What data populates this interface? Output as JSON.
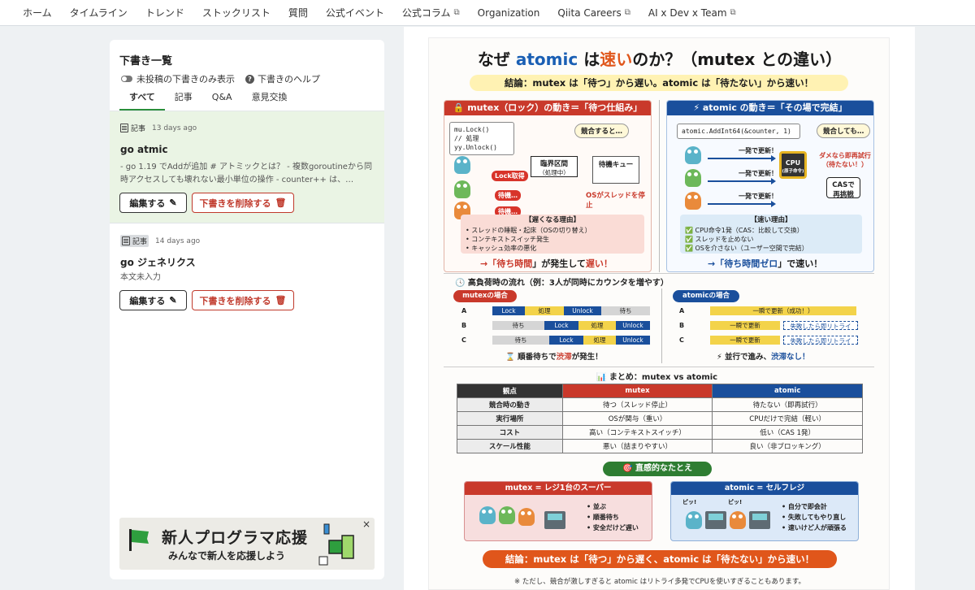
{
  "nav": {
    "items": [
      {
        "label": "ホーム",
        "external": false
      },
      {
        "label": "タイムライン",
        "external": false
      },
      {
        "label": "トレンド",
        "external": false
      },
      {
        "label": "ストックリスト",
        "external": false
      },
      {
        "label": "質問",
        "external": false
      },
      {
        "label": "公式イベント",
        "external": false
      },
      {
        "label": "公式コラム",
        "external": true
      },
      {
        "label": "Organization",
        "external": false
      },
      {
        "label": "Qiita Careers",
        "external": true
      },
      {
        "label": "AI x Dev x Team",
        "external": true
      }
    ]
  },
  "drafts_panel": {
    "title": "下書き一覧",
    "toggle_label": "未投稿の下書きのみ表示",
    "help_label": "下書きのヘルプ",
    "tabs": [
      {
        "label": "すべて",
        "active": true
      },
      {
        "label": "記事",
        "active": false
      },
      {
        "label": "Q&A",
        "active": false
      },
      {
        "label": "意見交換",
        "active": false
      }
    ],
    "drafts": [
      {
        "type": "記事",
        "time": "13 days ago",
        "title": "go atmic",
        "body": "- go 1.19 でAddが追加 # アトミックとは？ - 複数goroutineから同時アクセスしても壊れない最小単位の操作 - counter++ は、…",
        "edit_label": "編集する",
        "delete_label": "下書きを削除する",
        "selected": true
      },
      {
        "type": "記事",
        "time": "14 days ago",
        "title": "go ジェネリクス",
        "body": "本文未入力",
        "edit_label": "編集する",
        "delete_label": "下書きを削除する",
        "selected": false
      }
    ],
    "ad": {
      "line1": "新人プログラマ応援",
      "line2": "みんなで新人を応援しよう",
      "close": "×"
    }
  },
  "infographic": {
    "title_pre": "なぜ ",
    "title_atomic": "atomic",
    "title_mid": " は",
    "title_fast": "速い",
    "title_post": "のか？（mutex との違い）",
    "subtitle": "結論：mutex は「待つ」から遅い。atomic は「待たない」から速い！",
    "mutex_panel": {
      "header": "🔒 mutex（ロック）の動き＝「待つ仕組み」",
      "code": [
        "mu.Lock()",
        "// 処理",
        "yy.Unlock()"
      ],
      "bubble": "競合すると…",
      "lock_tag": "Lock取得",
      "wait1": "待機…",
      "wait2": "待機…",
      "critical": [
        "臨界区間",
        "（処理中）"
      ],
      "queue": "待機キュー",
      "os_stop": "OSがスレッドを停止",
      "reason_title": "【遅くなる理由】",
      "reasons": [
        "• スレッドの睡眠・起床（OSの切り替え）",
        "• コンテキストスイッチ発生",
        "• キャッシュ効率の悪化"
      ],
      "conclusion_pre": "→「",
      "conclusion_mid": "待ち時間",
      "conclusion_post": "」が発生して",
      "conclusion_end": "遅い！"
    },
    "atomic_panel": {
      "header": "⚡ atomic の動き＝「その場で完結」",
      "code": "atomic.AddInt64(&counter, 1)",
      "bubble": "競合しても…",
      "arrow_labels": [
        "一発で更新！",
        "一発で更新！",
        "一発で更新！"
      ],
      "cpu": [
        "CPU",
        "(原子命令)"
      ],
      "retry_note": [
        "ダメなら即再試行",
        "（待たない！）"
      ],
      "cas": [
        "CASで",
        "再挑戦"
      ],
      "reason_title": "【速い理由】",
      "reasons": [
        "✅ CPU命令1発（CAS：比較して交換）",
        "✅ スレッドを止めない",
        "✅ OSを介さない（ユーザー空間で完結）"
      ],
      "conclusion_pre": "→「",
      "conclusion_mid": "待ち時間ゼロ",
      "conclusion_post": "」で速い！"
    },
    "flow": {
      "header": "🕓 高負荷時の流れ（例：3人が同時にカウンタを増やす）",
      "mutex_label": "mutexの場合",
      "atomic_label": "atomicの場合",
      "lanes": [
        "A",
        "B",
        "C"
      ],
      "mutex_lanes": [
        [
          [
            "lock",
            "Lock"
          ],
          [
            "proc",
            "処理"
          ],
          [
            "lock",
            "Unlock"
          ],
          [
            "gray",
            "待ち"
          ]
        ],
        [
          [
            "gray",
            "待ち"
          ],
          [
            "lock",
            "Lock"
          ],
          [
            "proc",
            "処理"
          ],
          [
            "lock",
            "Unlock"
          ]
        ],
        [
          [
            "gray",
            "待ち"
          ],
          [
            "lock",
            "Lock"
          ],
          [
            "proc",
            "処理"
          ],
          [
            "lock",
            "Unlock"
          ]
        ]
      ],
      "atomic_lanes": [
        [
          [
            "proc",
            "一瞬で更新（成功！）"
          ]
        ],
        [
          [
            "proc",
            "一瞬で更新"
          ],
          [
            "dashed",
            "失敗したら即リトライ"
          ]
        ],
        [
          [
            "proc",
            "一瞬で更新"
          ],
          [
            "dashed",
            "失敗したら即リトライ"
          ]
        ]
      ],
      "mutex_foot_pre": "⌛ 順番待ちで",
      "mutex_foot_red": "渋滞",
      "mutex_foot_post": "が発生！",
      "atomic_foot_pre": "⚡ 並行で進み、",
      "atomic_foot_blue": "渋滞なし！"
    },
    "summary": {
      "header": "📊 まとめ：mutex vs atomic",
      "columns": [
        "観点",
        "mutex",
        "atomic"
      ],
      "rows": [
        [
          "競合時の動き",
          "待つ（スレッド停止）",
          "待たない（即再試行）"
        ],
        [
          "実行場所",
          "OSが関与（重い）",
          "CPUだけで完結（軽い）"
        ],
        [
          "コスト",
          "高い（コンテキストスイッチ）",
          "低い（CAS 1発）"
        ],
        [
          "スケール性能",
          "悪い（詰まりやすい）",
          "良い（非ブロッキング）"
        ]
      ]
    },
    "metaphor": {
      "header": "🎯 直感的なたとえ",
      "left_title": "mutex = レジ1台のスーパー",
      "left_items": [
        "• 並ぶ",
        "• 順番待ち",
        "• 安全だけど遅い"
      ],
      "right_title": "atomic = セルフレジ",
      "right_items": [
        "• 自分で即会計",
        "• 失敗してもやり直し",
        "• 速いけど人が頑張る"
      ],
      "beep": "ピッ!"
    },
    "final": "結論：mutex は「待つ」から遅く、atomic は「待たない」から速い！",
    "note": "※ ただし、競合が激しすぎると atomic はリトライ多発でCPUを使いすぎることもあります。"
  },
  "colors": {
    "accent_green": "#2a8f3a",
    "danger": "#c0392b",
    "mutex_red": "#c9392b",
    "atomic_blue": "#1a4f9c"
  }
}
